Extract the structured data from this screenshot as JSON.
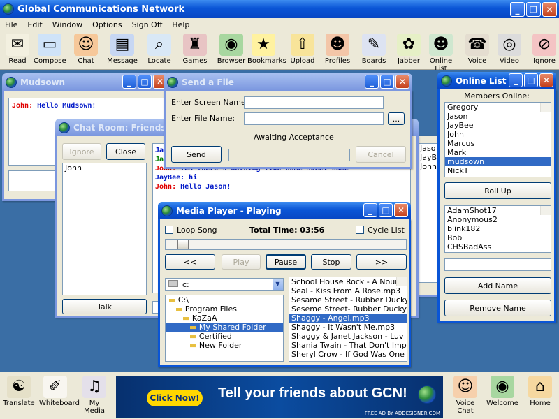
{
  "app": {
    "title": "Global Communications Network"
  },
  "menu": [
    "File",
    "Edit",
    "Window",
    "Options",
    "Sign Off",
    "Help"
  ],
  "toolbar": [
    {
      "label": "Read",
      "icon": "envelope-icon",
      "glyph": "✉",
      "color": "#f3f0e0"
    },
    {
      "label": "Compose",
      "icon": "compose-icon",
      "glyph": "▭",
      "color": "#cfe3f8"
    },
    {
      "label": "Chat",
      "icon": "chat-people-icon",
      "glyph": "☺",
      "color": "#f6c89a"
    },
    {
      "label": "Message",
      "icon": "message-icon",
      "glyph": "▤",
      "color": "#c7d7f3"
    },
    {
      "label": "Locate",
      "icon": "magnifier-icon",
      "glyph": "⌕",
      "color": "#d9e8f6"
    },
    {
      "label": "Games",
      "icon": "chess-icon",
      "glyph": "♜",
      "color": "#e8c4c4"
    },
    {
      "label": "Browser",
      "icon": "globe-icon",
      "glyph": "◉",
      "color": "#a8d7a0"
    },
    {
      "label": "Bookmarks",
      "icon": "star-icon",
      "glyph": "★",
      "color": "#fff2a0"
    },
    {
      "label": "Upload",
      "icon": "upload-folder-icon",
      "glyph": "⇧",
      "color": "#f8e49a"
    },
    {
      "label": "Profiles",
      "icon": "profiles-icon",
      "glyph": "☻",
      "color": "#f3c6a8"
    },
    {
      "label": "Boards",
      "icon": "boards-icon",
      "glyph": "✎",
      "color": "#dde3f2"
    },
    {
      "label": "Jabber",
      "icon": "jabber-icon",
      "glyph": "✿",
      "color": "#e6f0c6"
    },
    {
      "label": "Online List",
      "icon": "online-list-icon",
      "glyph": "☻",
      "color": "#cfe7cf"
    },
    {
      "label": "Voice",
      "icon": "voice-icon",
      "glyph": "☎",
      "color": "#e4ddd0"
    },
    {
      "label": "Video",
      "icon": "webcam-icon",
      "glyph": "◎",
      "color": "#dcdcdc"
    },
    {
      "label": "Ignore",
      "icon": "ignore-icon",
      "glyph": "⊘",
      "color": "#f4c4c4"
    }
  ],
  "mudsown": {
    "title": "Mudsown",
    "speaker": "John:",
    "message": "Hello Mudsown!"
  },
  "chatroom": {
    "title": "Chat Room: Friends",
    "ignore": "Ignore",
    "close": "Close",
    "members": [
      "John"
    ],
    "talk": "Talk",
    "log": [
      {
        "who": "Ja",
        "text": "",
        "cls": "blue"
      },
      {
        "who": "Ja",
        "text": "",
        "cls": "green"
      },
      {
        "who": "John:",
        "text": " Yes there's nothing like home sweet home",
        "cls": "red"
      },
      {
        "who": "JayBee:",
        "text": " hi",
        "cls": "blue"
      },
      {
        "who": "John:",
        "text": " Hello Jason!",
        "cls": "red"
      }
    ]
  },
  "sendfile": {
    "title": "Send a File",
    "screen_label": "Enter Screen Name:",
    "file_label": "Enter File Name:",
    "browse": "...",
    "status": "Awaiting Acceptance",
    "send": "Send",
    "cancel": "Cancel"
  },
  "mediaplayer": {
    "title": "Media Player -  Playing",
    "loop": "Loop Song",
    "total": "Total Time: 03:56",
    "cycle": "Cycle List",
    "prev": "<<",
    "play": "Play",
    "pause": "Pause",
    "stop": "Stop",
    "next": ">>",
    "progress": 0.05,
    "drive": "c:",
    "folders": [
      "C:\\",
      "Program Files",
      "KaZaA",
      "My Shared Folder",
      "Certified",
      "New Folder"
    ],
    "songs": [
      "School House Rock - A Noun i",
      "Seal - Kiss From A Rose.mp3",
      "Sesame Street - Rubber Ducky",
      "Seseme Street- Rubber Ducky",
      "Shaggy - Angel.mp3",
      "Shaggy - It Wasn't Me.mp3",
      "Shaggy & Janet Jackson - Luv",
      "Shania Twain - That Don't Impr",
      "Sheryl Crow - If God Was One"
    ]
  },
  "onlinelist": {
    "title": "Online List",
    "members_label": "Members Online:",
    "members": [
      "Gregory",
      "Jason",
      "JayBee",
      "John",
      "Marcus",
      "Mark",
      "mudsown",
      "NickT"
    ],
    "rollup": "Roll Up",
    "buddies": [
      "AdamShot17",
      "Anonymous2",
      "blink182",
      "Bob",
      "CHSBadAss"
    ],
    "add": "Add Name",
    "remove": "Remove Name"
  },
  "rightchat": {
    "names": [
      "Jaso",
      "JayB",
      "John"
    ]
  },
  "bottom": [
    {
      "label": "Translate",
      "icon": "translate-icon"
    },
    {
      "label": "Whiteboard",
      "icon": "whiteboard-icon"
    },
    {
      "label": "My Media",
      "icon": "media-icon"
    },
    {
      "label": "Voice Chat",
      "icon": "voice-chat-icon"
    },
    {
      "label": "Welcome",
      "icon": "globe-icon"
    },
    {
      "label": "Home",
      "icon": "home-icon"
    }
  ],
  "ad": {
    "button": "Click Now!",
    "headline": "Tell your friends about GCN!",
    "credit": "FREE AD BY ADDESIGNER.COM"
  }
}
